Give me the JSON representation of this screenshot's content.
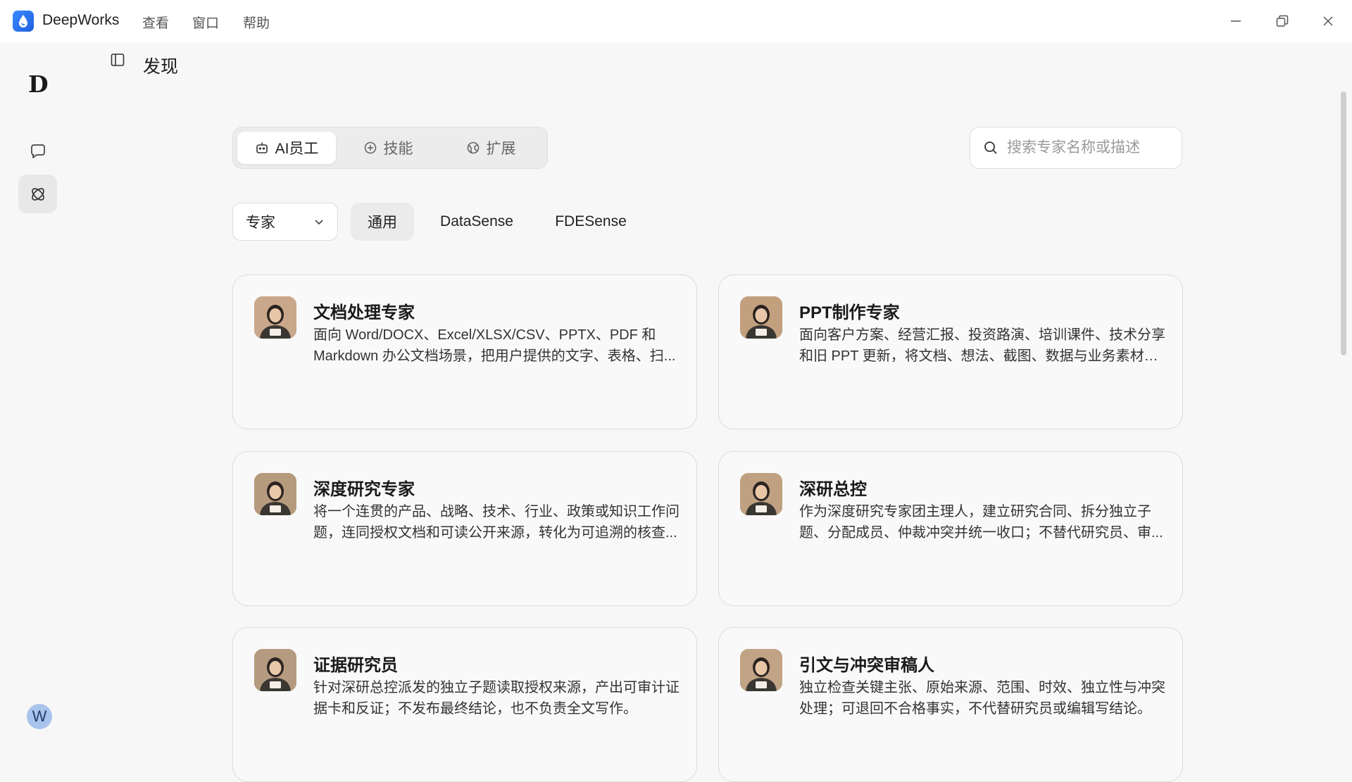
{
  "app": {
    "name": "DeepWorks",
    "brand_color": "#2f7cf6"
  },
  "menu": {
    "items": [
      "查看",
      "窗口",
      "帮助"
    ]
  },
  "rail": {
    "logo_letter": "D",
    "user_initial": "W"
  },
  "page": {
    "title": "发现"
  },
  "tabs": [
    {
      "label": "AI员工",
      "icon": "robot-icon",
      "active": true
    },
    {
      "label": "技能",
      "icon": "plus-circle-icon",
      "active": false
    },
    {
      "label": "扩展",
      "icon": "globe-icon",
      "active": false
    }
  ],
  "search": {
    "placeholder": "搜索专家名称或描述"
  },
  "filters": {
    "dropdown_value": "专家",
    "chips": [
      "通用",
      "DataSense",
      "FDESense"
    ],
    "active_chip": "通用"
  },
  "cards": [
    {
      "title": "文档处理专家",
      "desc": "面向 Word/DOCX、Excel/XLSX/CSV、PPTX、PDF 和 Markdown 办公文档场景，把用户提供的文字、表格、扫...",
      "avatar_color": "#c9a78a"
    },
    {
      "title": "PPT制作专家",
      "desc": "面向客户方案、经营汇报、投资路演、培训课件、技术分享和旧 PPT 更新，将文档、想法、截图、数据与业务素材转...",
      "avatar_color": "#c2a07e"
    },
    {
      "title": "深度研究专家",
      "desc": "将一个连贯的产品、战略、技术、行业、政策或知识工作问题，连同授权文档和可读公开来源，转化为可追溯的核查...",
      "avatar_color": "#b59a7c"
    },
    {
      "title": "深研总控",
      "desc": "作为深度研究专家团主理人，建立研究合同、拆分独立子题、分配成员、仲裁冲突并统一收口；不替代研究员、审...",
      "avatar_color": "#bfa182"
    },
    {
      "title": "证据研究员",
      "desc": "针对深研总控派发的独立子题读取授权来源，产出可审计证据卡和反证；不发布最终结论，也不负责全文写作。",
      "avatar_color": "#b49a7e"
    },
    {
      "title": "引文与冲突审稿人",
      "desc": "独立检查关键主张、原始来源、范围、时效、独立性与冲突处理；可退回不合格事实，不代替研究员或编辑写结论。",
      "avatar_color": "#c1a385"
    }
  ]
}
